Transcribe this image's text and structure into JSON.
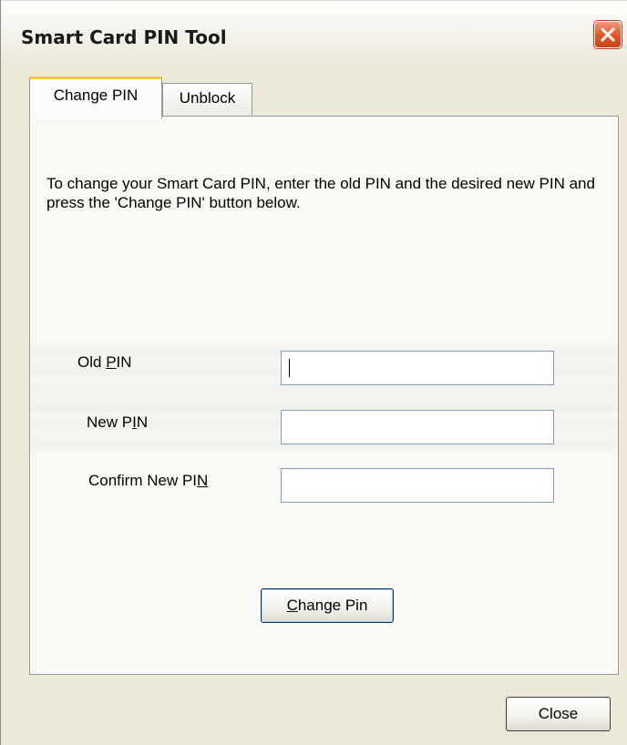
{
  "window": {
    "title": "Smart Card PIN Tool"
  },
  "tabs": [
    {
      "label": "Change PIN",
      "active": true
    },
    {
      "label": "Unblock",
      "active": false
    }
  ],
  "panel": {
    "instructions": "To change your Smart Card PIN, enter the old PIN and the desired new PIN and press the 'Change PIN' button below.",
    "fields": [
      {
        "label_pre": "Old ",
        "label_mnemonic": "P",
        "label_post": "IN",
        "value": ""
      },
      {
        "label_pre": "New P",
        "label_mnemonic": "I",
        "label_post": "N",
        "value": ""
      },
      {
        "label_pre": "Confirm New PI",
        "label_mnemonic": "N",
        "label_post": "",
        "value": ""
      }
    ],
    "change_button": {
      "mnemonic": "C",
      "rest": "hange Pin"
    }
  },
  "footer": {
    "close_label": "Close"
  },
  "colors": {
    "active_tab_highlight": "#ffc83c",
    "close_button": "#e3592d",
    "input_border": "#7f9db9"
  },
  "icons": {
    "close": "close-icon"
  }
}
